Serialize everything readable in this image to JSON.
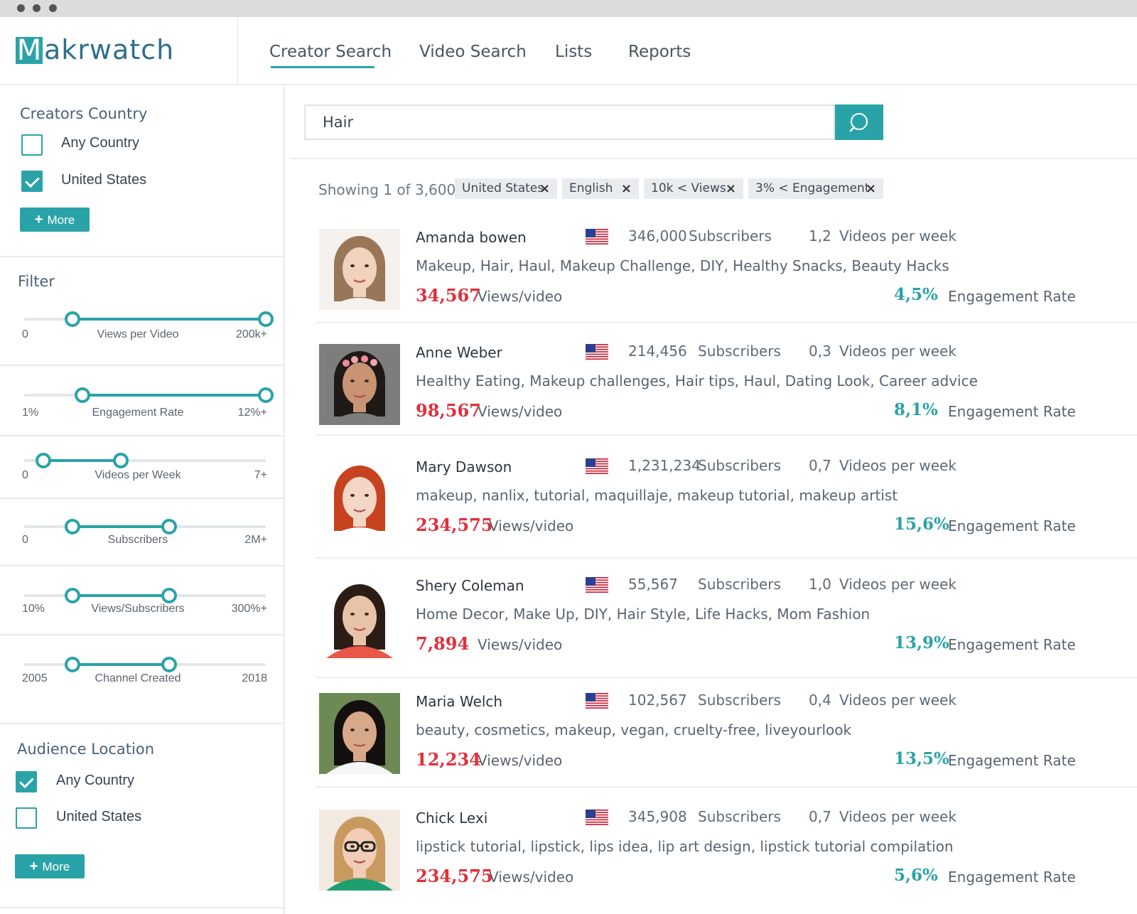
{
  "app": {
    "logo_letter": "M",
    "logo_rest": "akrwatch",
    "accent": "#2aa3a8",
    "highlight_red": "#e0303a"
  },
  "nav": {
    "tabs": [
      {
        "label": "Creator Search",
        "active": true
      },
      {
        "label": "Video Search",
        "active": false
      },
      {
        "label": "Lists",
        "active": false
      },
      {
        "label": "Reports",
        "active": false
      }
    ]
  },
  "sidebar": {
    "creators_country": {
      "title": "Creators Country",
      "options": [
        {
          "label": "Any Country",
          "checked": false
        },
        {
          "label": "United States",
          "checked": true
        }
      ],
      "more_label": "More"
    },
    "filter": {
      "title": "Filter",
      "sliders": [
        {
          "label": "Views per Video",
          "min_label": "0",
          "max_label": "200k+",
          "low": 0.2,
          "high": 1.0
        },
        {
          "label": "Engagement Rate",
          "min_label": "1%",
          "max_label": "12%+",
          "low": 0.24,
          "high": 1.0
        },
        {
          "label": "Videos per Week",
          "min_label": "0",
          "max_label": "7+",
          "low": 0.08,
          "high": 0.4
        },
        {
          "label": "Subscribers",
          "min_label": "0",
          "max_label": "2M+",
          "low": 0.2,
          "high": 0.6
        },
        {
          "label": "Views/Subscribers",
          "min_label": "10%",
          "max_label": "300%+",
          "low": 0.2,
          "high": 0.6
        },
        {
          "label": "Channel Created",
          "min_label": "2005",
          "max_label": "2018",
          "low": 0.2,
          "high": 0.6
        }
      ]
    },
    "audience_location": {
      "title": "Audience Location",
      "options": [
        {
          "label": "Any Country",
          "checked": true
        },
        {
          "label": "United States",
          "checked": false
        }
      ],
      "more_label": "More"
    }
  },
  "search": {
    "value": "Hair",
    "icon": "search-icon"
  },
  "results": {
    "showing": "Showing 1 of 3,600",
    "chips": [
      "United States",
      "English",
      "10k < Views",
      "3% < Engagement"
    ],
    "items": [
      {
        "name": "Amanda bowen",
        "subscribers": "346,000",
        "subscribers_label": "Subscribers",
        "videos_week": "1,2",
        "videos_week_label": "Videos per week",
        "tags": "Makeup, Hair, Haul, Makeup Challenge, DIY, Healthy Snacks, Beauty Hacks",
        "views": "34,567",
        "views_label": "Views/video",
        "engagement": "4,5%",
        "engagement_label": "Engagement Rate"
      },
      {
        "name": "Anne Weber",
        "subscribers": "214,456",
        "subscribers_label": "Subscribers",
        "videos_week": "0,3",
        "videos_week_label": "Videos per week",
        "tags": "Healthy Eating, Makeup challenges, Hair tips, Haul, Dating Look, Career advice",
        "views": "98,567",
        "views_label": "Views/video",
        "engagement": "8,1%",
        "engagement_label": "Engagement Rate"
      },
      {
        "name": "Mary Dawson",
        "subscribers": "1,231,234",
        "subscribers_label": "Subscribers",
        "videos_week": "0,7",
        "videos_week_label": "Videos per week",
        "tags": "makeup, nanlix, tutorial, maquillaje, makeup tutorial, makeup artist",
        "views": "234,575",
        "views_label": "Views/video",
        "engagement": "15,6%",
        "engagement_label": "Engagement Rate"
      },
      {
        "name": "Shery Coleman",
        "subscribers": "55,567",
        "subscribers_label": "Subscribers",
        "videos_week": "1,0",
        "videos_week_label": "Videos per week",
        "tags": "Home Decor, Make Up, DIY, Hair Style, Life Hacks, Mom Fashion",
        "views": "7,894",
        "views_label": "Views/video",
        "engagement": "13,9%",
        "engagement_label": "Engagement Rate"
      },
      {
        "name": "Maria Welch",
        "subscribers": "102,567",
        "subscribers_label": "Subscribers",
        "videos_week": "0,4",
        "videos_week_label": "Videos per week",
        "tags": "beauty, cosmetics, makeup, vegan, cruelty-free, liveyourlook",
        "views": "12,234",
        "views_label": "Views/video",
        "engagement": "13,5%",
        "engagement_label": "Engagement Rate"
      },
      {
        "name": "Chick Lexi",
        "subscribers": "345,908",
        "subscribers_label": "Subscribers",
        "videos_week": "0,7",
        "videos_week_label": "Videos per week",
        "tags": "lipstick tutorial, lipstick, lips idea, lip art design, lipstick tutorial compilation",
        "views": "234,575",
        "views_label": "Views/video",
        "engagement": "5,6%",
        "engagement_label": "Engagement Rate"
      }
    ]
  }
}
